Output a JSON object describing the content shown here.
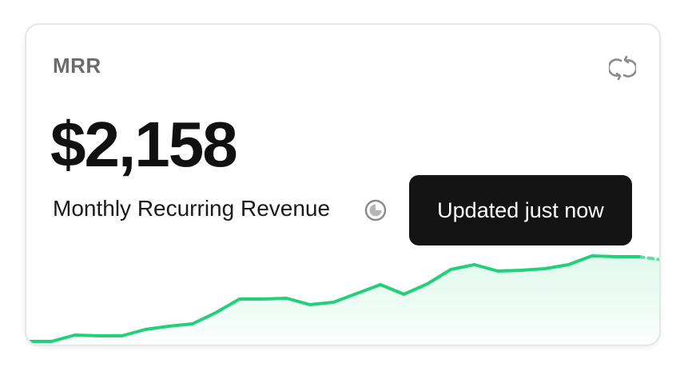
{
  "card": {
    "title": "MRR",
    "value": "$2,158",
    "label": "Monthly Recurring Revenue",
    "tooltip": "Updated just now"
  },
  "icons": {
    "refresh": "refresh-icon",
    "info": "clock-info-icon"
  },
  "colors": {
    "accent": "#22d07a",
    "tooltip_bg": "#141414",
    "title": "#6b6b6b"
  },
  "chart_data": {
    "type": "area",
    "values": [
      2,
      2,
      10,
      9,
      9,
      17,
      21,
      24,
      38,
      55,
      55,
      56,
      48,
      51,
      62,
      73,
      61,
      74,
      92,
      98,
      90,
      91,
      93,
      98,
      109,
      108,
      108
    ],
    "projected_values": [
      108,
      104
    ],
    "grid": false,
    "legend": "none"
  }
}
